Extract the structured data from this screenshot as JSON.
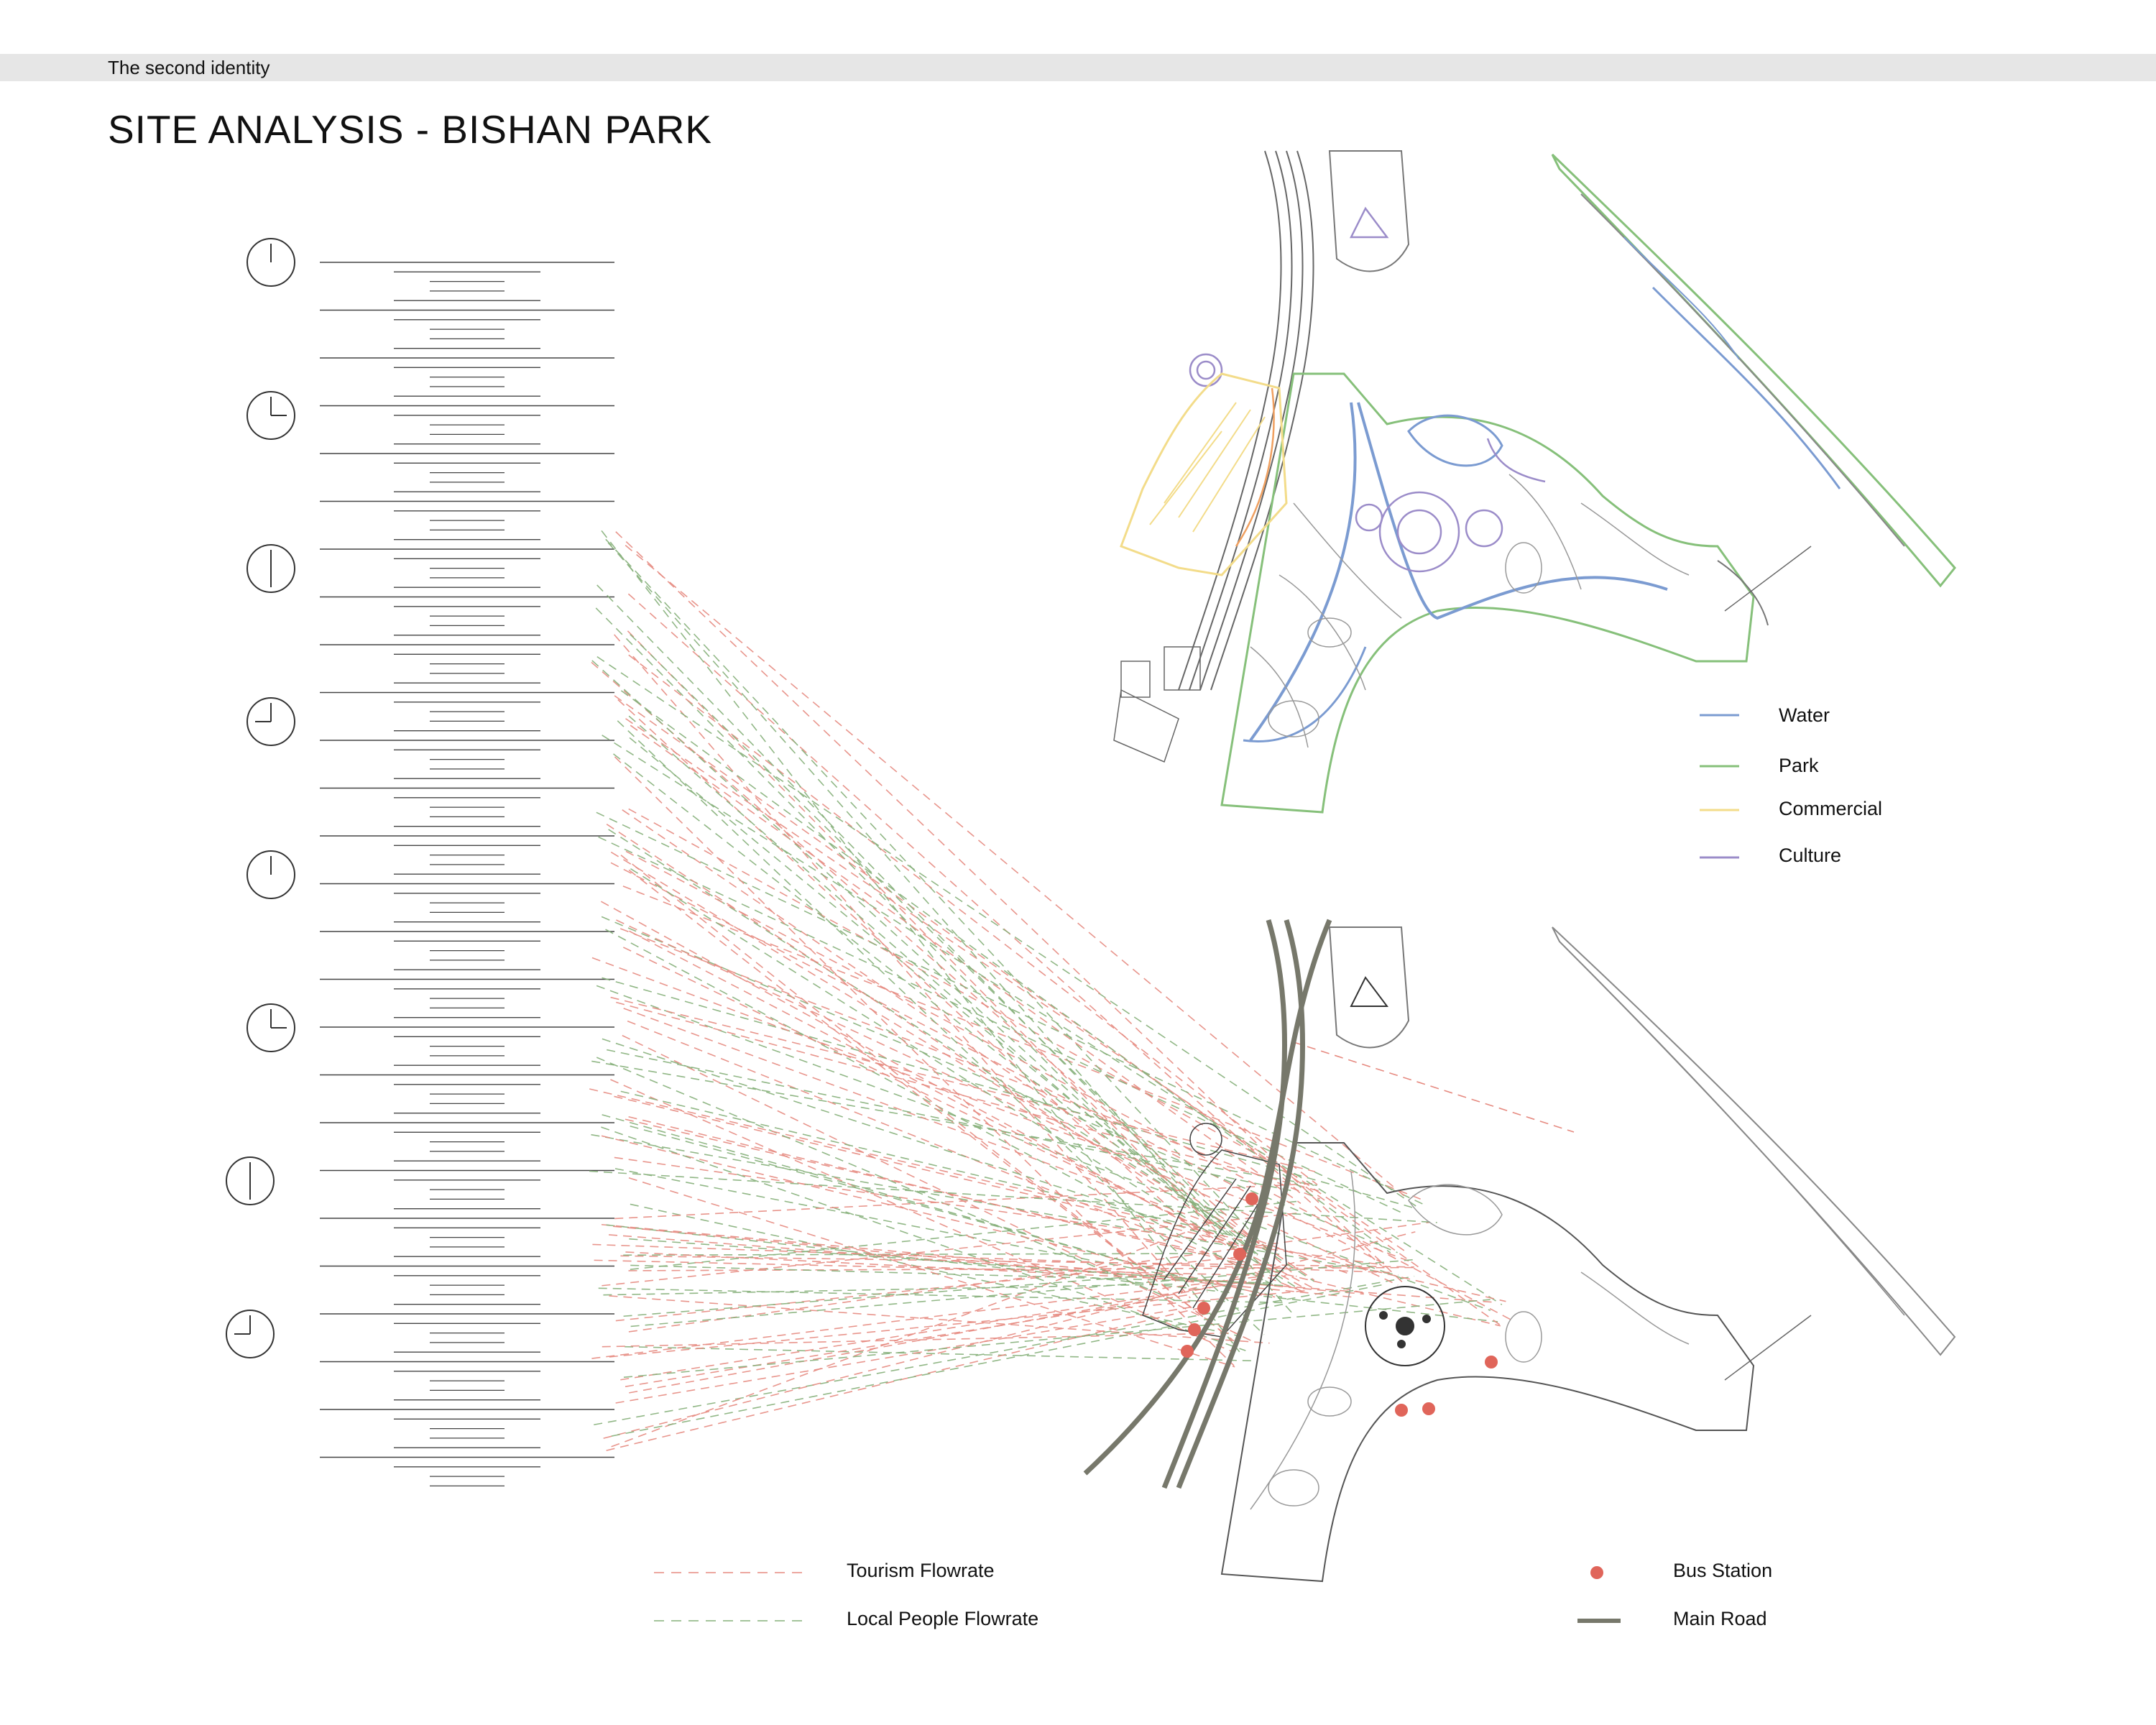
{
  "header": {
    "project_label": "The second identity"
  },
  "page": {
    "title": "SITE ANALYSIS - BISHAN PARK"
  },
  "zoning_legend": [
    {
      "label": "Water",
      "color": "#7b9bd1"
    },
    {
      "label": "Park",
      "color": "#86c07a"
    },
    {
      "label": "Commercial",
      "color": "#f3dc8a"
    },
    {
      "label": "Culture",
      "color": "#9b8cc9"
    }
  ],
  "flow_legend": [
    {
      "label": "Tourism Flowrate",
      "color": "#e68a80"
    },
    {
      "label": "Local People Flowrate",
      "color": "#86b07a"
    }
  ],
  "infrastructure_legend": [
    {
      "label": "Bus Station",
      "color": "#e0655a",
      "icon": "bus-station-dot-icon"
    },
    {
      "label": "Main Road",
      "color": "#77786b",
      "icon": "main-road-line-icon"
    }
  ],
  "timeline": {
    "clocks": [
      {
        "icon": "clock-12-icon",
        "hour": 12
      },
      {
        "icon": "clock-3-icon",
        "hour": 3
      },
      {
        "icon": "clock-6-icon",
        "hour": 6
      },
      {
        "icon": "clock-9-icon",
        "hour": 9
      },
      {
        "icon": "clock-12-icon",
        "hour": 12
      },
      {
        "icon": "clock-3-icon",
        "hour": 3
      },
      {
        "icon": "clock-6-icon",
        "hour": 6
      },
      {
        "icon": "clock-9-icon",
        "hour": 9
      }
    ]
  },
  "colors": {
    "water": "#7b9bd1",
    "park": "#86c07a",
    "commercial": "#f3dc8a",
    "culture": "#9b8cc9",
    "tourism_flow": "#e68a80",
    "local_flow": "#86b07a",
    "bus_station": "#e0655a",
    "main_road": "#77786b",
    "linework": "#555555"
  }
}
